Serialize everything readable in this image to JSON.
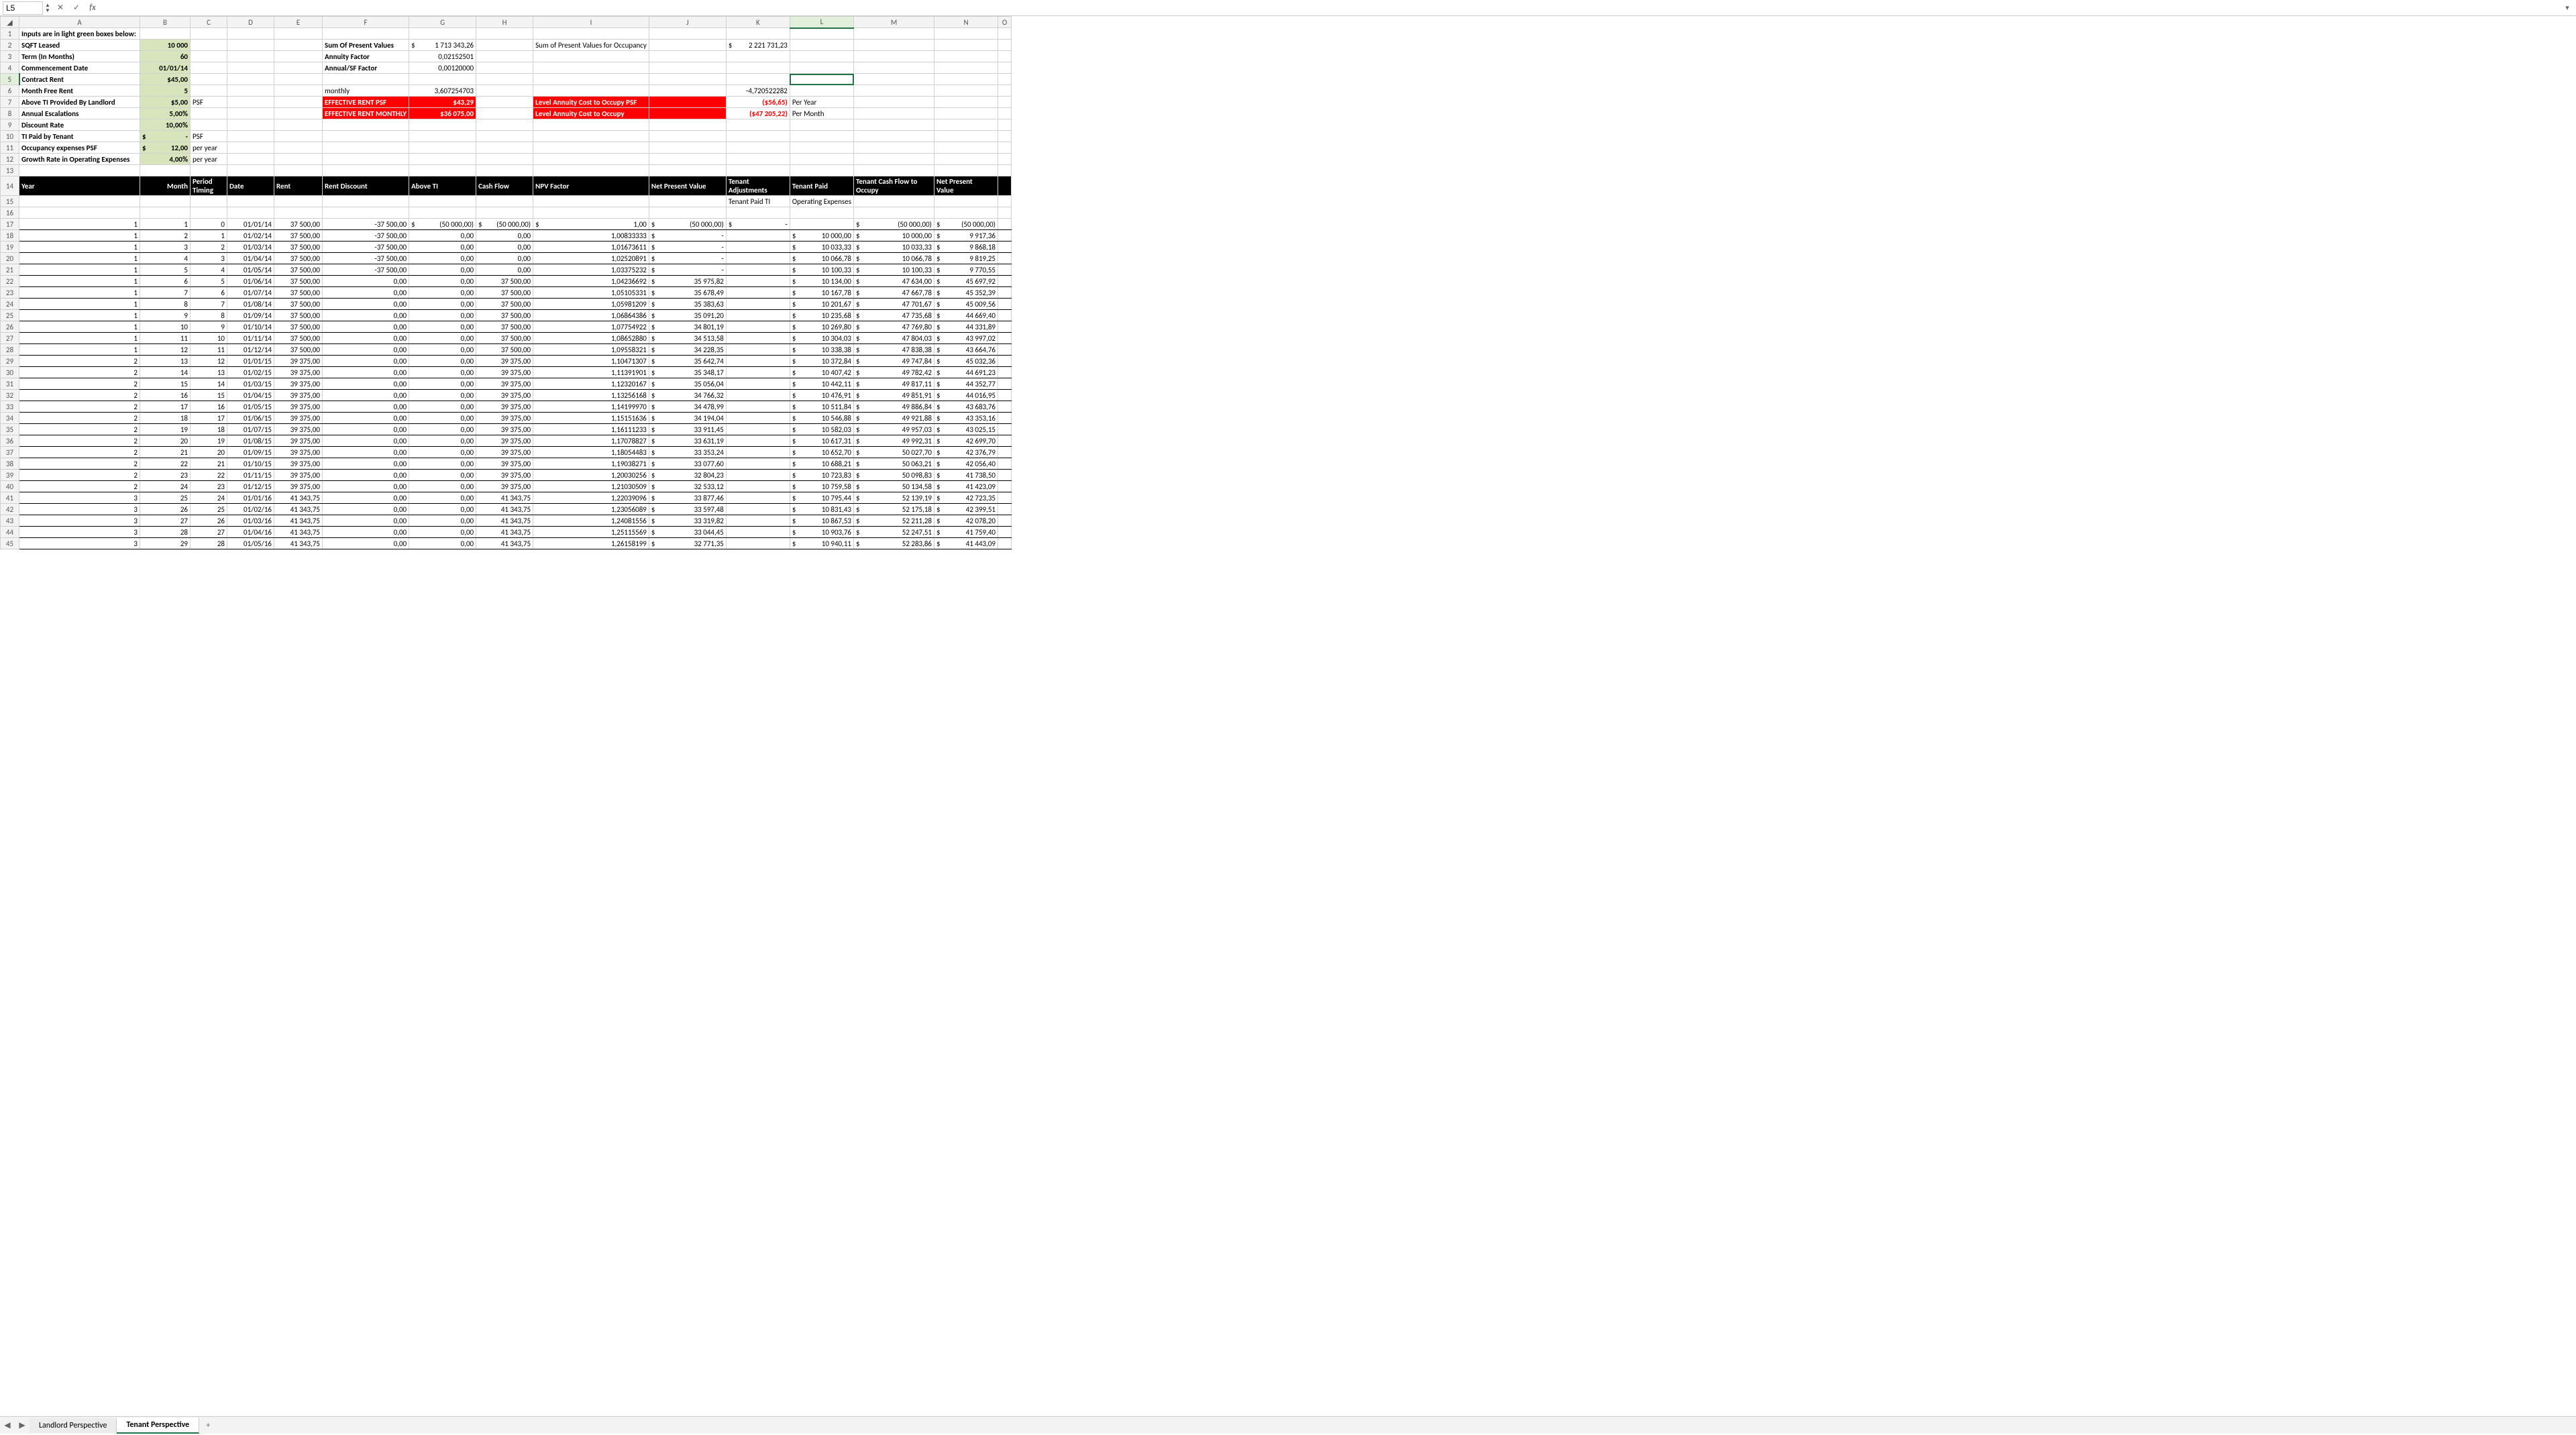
{
  "formula_bar": {
    "name_box": "L5",
    "fx": "fx",
    "input": ""
  },
  "inputs": {
    "title": "Inputs are in light green boxes below:",
    "labels": {
      "sqft": "SQFT Leased",
      "term": "Term (In Months)",
      "comm": "Commencement Date",
      "crent": "Contract Rent",
      "mfree": "Month Free Rent",
      "ati": "Above TI Provided By Landlord",
      "esc": "Annual Escalations",
      "disc": "Discount Rate",
      "tip": "TI Paid by Tenant",
      "occ": "Occupancy expenses PSF",
      "grow": "Growth Rate in Operating Expenses"
    },
    "values": {
      "sqft": "10 000",
      "term": "60",
      "comm": "01/01/14",
      "crent": "$45,00",
      "mfree": "5",
      "ati": "$5,00",
      "esc": "5,00%",
      "disc": "10,00%",
      "tip": "-",
      "occ": "12,00",
      "grow": "4,00%"
    },
    "units": {
      "ati": "PSF",
      "tip": "PSF",
      "occ": "per year",
      "grow": "per year"
    }
  },
  "summary": {
    "spv_lbl": "Sum Of Present Values",
    "spv_val": "1 713 343,26",
    "af_lbl": "Annuity Factor",
    "af_val": "0,02152501",
    "asf_lbl": "Annual/SF Factor",
    "asf_val": "0,00120000",
    "monthly_lbl": "monthly",
    "monthly_val": "3,607254703",
    "erpsf_lbl": "EFFECTIVE RENT PSF",
    "erpsf_val": "$43,29",
    "erm_lbl": "EFFECTIVE RENT MONTHLY",
    "erm_val": "$36 075,00",
    "spv_occ_lbl": "Sum of Present Values for Occupancy",
    "spv_occ_val": "2 221 731,23",
    "neg_val": "-4,720522282",
    "lac_psf_lbl": "Level Annuity Cost to Occupy PSF",
    "lac_psf_val": "($56,65)",
    "lac_psf_unit": "Per Year",
    "lac_lbl": "Level Annuity Cost to Occupy",
    "lac_val": "($47 205,22)",
    "lac_unit": "Per Month"
  },
  "headers": {
    "year": "Year",
    "month": "Month",
    "pt1": "Period",
    "pt2": "Timing",
    "date": "Date",
    "rent": "Rent",
    "rdisc": "Rent Discount",
    "ati": "Above TI",
    "cf": "Cash Flow",
    "npvf": "NPV Factor",
    "npv": "Net Present Value",
    "ta1": "Tenant",
    "ta2": "Adjustments",
    "tp": "Tenant Paid",
    "tcfo1": "Tenant Cash Flow to",
    "tcfo2": "Occupy",
    "npv2": "Net Present",
    "npv2b": "Value",
    "sub_tpti": "Tenant Paid TI",
    "sub_oe": "Operating Expenses"
  },
  "rows": [
    {
      "y": "1",
      "m": "1",
      "pt": "0",
      "d": "01/01/14",
      "r": "37 500,00",
      "rd": "-37 500,00",
      "at": "(50 000,00)",
      "cf": "(50 000,00)",
      "nf": "1,00",
      "nv": "(50 000,00)",
      "ta": "-",
      "tp": "",
      "tcfo": "(50 000,00)",
      "npv": "(50 000,00)"
    },
    {
      "y": "1",
      "m": "2",
      "pt": "1",
      "d": "01/02/14",
      "r": "37 500,00",
      "rd": "-37 500,00",
      "at": "0,00",
      "cf": "0,00",
      "nf": "1,00833333",
      "nv": "-",
      "ta": "",
      "tp": "10 000,00",
      "tcfo": "10 000,00",
      "npv": "9 917,36"
    },
    {
      "y": "1",
      "m": "3",
      "pt": "2",
      "d": "01/03/14",
      "r": "37 500,00",
      "rd": "-37 500,00",
      "at": "0,00",
      "cf": "0,00",
      "nf": "1,01673611",
      "nv": "-",
      "ta": "",
      "tp": "10 033,33",
      "tcfo": "10 033,33",
      "npv": "9 868,18"
    },
    {
      "y": "1",
      "m": "4",
      "pt": "3",
      "d": "01/04/14",
      "r": "37 500,00",
      "rd": "-37 500,00",
      "at": "0,00",
      "cf": "0,00",
      "nf": "1,02520891",
      "nv": "-",
      "ta": "",
      "tp": "10 066,78",
      "tcfo": "10 066,78",
      "npv": "9 819,25"
    },
    {
      "y": "1",
      "m": "5",
      "pt": "4",
      "d": "01/05/14",
      "r": "37 500,00",
      "rd": "-37 500,00",
      "at": "0,00",
      "cf": "0,00",
      "nf": "1,03375232",
      "nv": "-",
      "ta": "",
      "tp": "10 100,33",
      "tcfo": "10 100,33",
      "npv": "9 770,55"
    },
    {
      "y": "1",
      "m": "6",
      "pt": "5",
      "d": "01/06/14",
      "r": "37 500,00",
      "rd": "0,00",
      "at": "0,00",
      "cf": "37 500,00",
      "nf": "1,04236692",
      "nv": "35 975,82",
      "ta": "",
      "tp": "10 134,00",
      "tcfo": "47 634,00",
      "npv": "45 697,92"
    },
    {
      "y": "1",
      "m": "7",
      "pt": "6",
      "d": "01/07/14",
      "r": "37 500,00",
      "rd": "0,00",
      "at": "0,00",
      "cf": "37 500,00",
      "nf": "1,05105331",
      "nv": "35 678,49",
      "ta": "",
      "tp": "10 167,78",
      "tcfo": "47 667,78",
      "npv": "45 352,39"
    },
    {
      "y": "1",
      "m": "8",
      "pt": "7",
      "d": "01/08/14",
      "r": "37 500,00",
      "rd": "0,00",
      "at": "0,00",
      "cf": "37 500,00",
      "nf": "1,05981209",
      "nv": "35 383,63",
      "ta": "",
      "tp": "10 201,67",
      "tcfo": "47 701,67",
      "npv": "45 009,56"
    },
    {
      "y": "1",
      "m": "9",
      "pt": "8",
      "d": "01/09/14",
      "r": "37 500,00",
      "rd": "0,00",
      "at": "0,00",
      "cf": "37 500,00",
      "nf": "1,06864386",
      "nv": "35 091,20",
      "ta": "",
      "tp": "10 235,68",
      "tcfo": "47 735,68",
      "npv": "44 669,40"
    },
    {
      "y": "1",
      "m": "10",
      "pt": "9",
      "d": "01/10/14",
      "r": "37 500,00",
      "rd": "0,00",
      "at": "0,00",
      "cf": "37 500,00",
      "nf": "1,07754922",
      "nv": "34 801,19",
      "ta": "",
      "tp": "10 269,80",
      "tcfo": "47 769,80",
      "npv": "44 331,89"
    },
    {
      "y": "1",
      "m": "11",
      "pt": "10",
      "d": "01/11/14",
      "r": "37 500,00",
      "rd": "0,00",
      "at": "0,00",
      "cf": "37 500,00",
      "nf": "1,08652880",
      "nv": "34 513,58",
      "ta": "",
      "tp": "10 304,03",
      "tcfo": "47 804,03",
      "npv": "43 997,02"
    },
    {
      "y": "1",
      "m": "12",
      "pt": "11",
      "d": "01/12/14",
      "r": "37 500,00",
      "rd": "0,00",
      "at": "0,00",
      "cf": "37 500,00",
      "nf": "1,09558321",
      "nv": "34 228,35",
      "ta": "",
      "tp": "10 338,38",
      "tcfo": "47 838,38",
      "npv": "43 664,76"
    },
    {
      "y": "2",
      "m": "13",
      "pt": "12",
      "d": "01/01/15",
      "r": "39 375,00",
      "rd": "0,00",
      "at": "0,00",
      "cf": "39 375,00",
      "nf": "1,10471307",
      "nv": "35 642,74",
      "ta": "",
      "tp": "10 372,84",
      "tcfo": "49 747,84",
      "npv": "45 032,36"
    },
    {
      "y": "2",
      "m": "14",
      "pt": "13",
      "d": "01/02/15",
      "r": "39 375,00",
      "rd": "0,00",
      "at": "0,00",
      "cf": "39 375,00",
      "nf": "1,11391901",
      "nv": "35 348,17",
      "ta": "",
      "tp": "10 407,42",
      "tcfo": "49 782,42",
      "npv": "44 691,23"
    },
    {
      "y": "2",
      "m": "15",
      "pt": "14",
      "d": "01/03/15",
      "r": "39 375,00",
      "rd": "0,00",
      "at": "0,00",
      "cf": "39 375,00",
      "nf": "1,12320167",
      "nv": "35 056,04",
      "ta": "",
      "tp": "10 442,11",
      "tcfo": "49 817,11",
      "npv": "44 352,77"
    },
    {
      "y": "2",
      "m": "16",
      "pt": "15",
      "d": "01/04/15",
      "r": "39 375,00",
      "rd": "0,00",
      "at": "0,00",
      "cf": "39 375,00",
      "nf": "1,13256168",
      "nv": "34 766,32",
      "ta": "",
      "tp": "10 476,91",
      "tcfo": "49 851,91",
      "npv": "44 016,95"
    },
    {
      "y": "2",
      "m": "17",
      "pt": "16",
      "d": "01/05/15",
      "r": "39 375,00",
      "rd": "0,00",
      "at": "0,00",
      "cf": "39 375,00",
      "nf": "1,14199970",
      "nv": "34 478,99",
      "ta": "",
      "tp": "10 511,84",
      "tcfo": "49 886,84",
      "npv": "43 683,76"
    },
    {
      "y": "2",
      "m": "18",
      "pt": "17",
      "d": "01/06/15",
      "r": "39 375,00",
      "rd": "0,00",
      "at": "0,00",
      "cf": "39 375,00",
      "nf": "1,15151636",
      "nv": "34 194,04",
      "ta": "",
      "tp": "10 546,88",
      "tcfo": "49 921,88",
      "npv": "43 353,16"
    },
    {
      "y": "2",
      "m": "19",
      "pt": "18",
      "d": "01/07/15",
      "r": "39 375,00",
      "rd": "0,00",
      "at": "0,00",
      "cf": "39 375,00",
      "nf": "1,16111233",
      "nv": "33 911,45",
      "ta": "",
      "tp": "10 582,03",
      "tcfo": "49 957,03",
      "npv": "43 025,15"
    },
    {
      "y": "2",
      "m": "20",
      "pt": "19",
      "d": "01/08/15",
      "r": "39 375,00",
      "rd": "0,00",
      "at": "0,00",
      "cf": "39 375,00",
      "nf": "1,17078827",
      "nv": "33 631,19",
      "ta": "",
      "tp": "10 617,31",
      "tcfo": "49 992,31",
      "npv": "42 699,70"
    },
    {
      "y": "2",
      "m": "21",
      "pt": "20",
      "d": "01/09/15",
      "r": "39 375,00",
      "rd": "0,00",
      "at": "0,00",
      "cf": "39 375,00",
      "nf": "1,18054483",
      "nv": "33 353,24",
      "ta": "",
      "tp": "10 652,70",
      "tcfo": "50 027,70",
      "npv": "42 376,79"
    },
    {
      "y": "2",
      "m": "22",
      "pt": "21",
      "d": "01/10/15",
      "r": "39 375,00",
      "rd": "0,00",
      "at": "0,00",
      "cf": "39 375,00",
      "nf": "1,19038271",
      "nv": "33 077,60",
      "ta": "",
      "tp": "10 688,21",
      "tcfo": "50 063,21",
      "npv": "42 056,40"
    },
    {
      "y": "2",
      "m": "23",
      "pt": "22",
      "d": "01/11/15",
      "r": "39 375,00",
      "rd": "0,00",
      "at": "0,00",
      "cf": "39 375,00",
      "nf": "1,20030256",
      "nv": "32 804,23",
      "ta": "",
      "tp": "10 723,83",
      "tcfo": "50 098,83",
      "npv": "41 738,50"
    },
    {
      "y": "2",
      "m": "24",
      "pt": "23",
      "d": "01/12/15",
      "r": "39 375,00",
      "rd": "0,00",
      "at": "0,00",
      "cf": "39 375,00",
      "nf": "1,21030509",
      "nv": "32 533,12",
      "ta": "",
      "tp": "10 759,58",
      "tcfo": "50 134,58",
      "npv": "41 423,09"
    },
    {
      "y": "3",
      "m": "25",
      "pt": "24",
      "d": "01/01/16",
      "r": "41 343,75",
      "rd": "0,00",
      "at": "0,00",
      "cf": "41 343,75",
      "nf": "1,22039096",
      "nv": "33 877,46",
      "ta": "",
      "tp": "10 795,44",
      "tcfo": "52 139,19",
      "npv": "42 723,35"
    },
    {
      "y": "3",
      "m": "26",
      "pt": "25",
      "d": "01/02/16",
      "r": "41 343,75",
      "rd": "0,00",
      "at": "0,00",
      "cf": "41 343,75",
      "nf": "1,23056089",
      "nv": "33 597,48",
      "ta": "",
      "tp": "10 831,43",
      "tcfo": "52 175,18",
      "npv": "42 399,51"
    },
    {
      "y": "3",
      "m": "27",
      "pt": "26",
      "d": "01/03/16",
      "r": "41 343,75",
      "rd": "0,00",
      "at": "0,00",
      "cf": "41 343,75",
      "nf": "1,24081556",
      "nv": "33 319,82",
      "ta": "",
      "tp": "10 867,53",
      "tcfo": "52 211,28",
      "npv": "42 078,20"
    },
    {
      "y": "3",
      "m": "28",
      "pt": "27",
      "d": "01/04/16",
      "r": "41 343,75",
      "rd": "0,00",
      "at": "0,00",
      "cf": "41 343,75",
      "nf": "1,25115569",
      "nv": "33 044,45",
      "ta": "",
      "tp": "10 903,76",
      "tcfo": "52 247,51",
      "npv": "41 759,40"
    },
    {
      "y": "3",
      "m": "29",
      "pt": "28",
      "d": "01/05/16",
      "r": "41 343,75",
      "rd": "0,00",
      "at": "0,00",
      "cf": "41 343,75",
      "nf": "1,26158199",
      "nv": "32 771,35",
      "ta": "",
      "tp": "10 940,11",
      "tcfo": "52 283,86",
      "npv": "41 443,09"
    }
  ],
  "tabs": {
    "prev": "◀",
    "next": "▶",
    "t1": "Landlord Perspective",
    "t2": "Tenant Perspective",
    "add": "+"
  }
}
